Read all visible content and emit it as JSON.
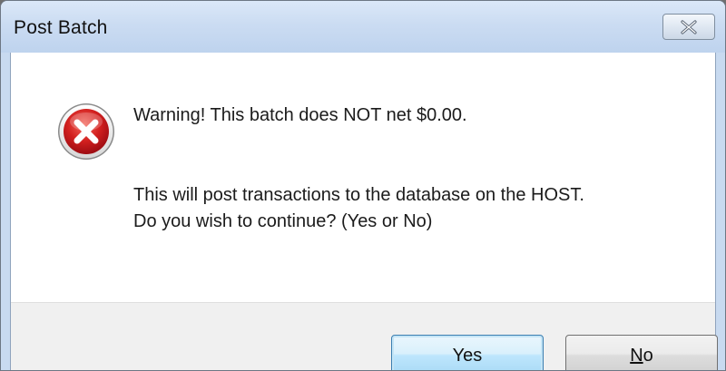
{
  "dialog": {
    "title": "Post Batch",
    "close_icon": "close-icon",
    "message_icon": "error-icon",
    "message_line1": "Warning! This batch does NOT net $0.00.",
    "message_line2": "This will post transactions to the database on the HOST.",
    "message_line3": "Do you wish to continue? (Yes or No)"
  },
  "buttons": {
    "yes_label": "Yes",
    "no_accel": "N",
    "no_rest": "o"
  },
  "colors": {
    "error_red": "#c8151b",
    "title_bar": "#c8daf0",
    "button_bar": "#f0f0f0",
    "default_button_border": "#3c7fb1"
  }
}
